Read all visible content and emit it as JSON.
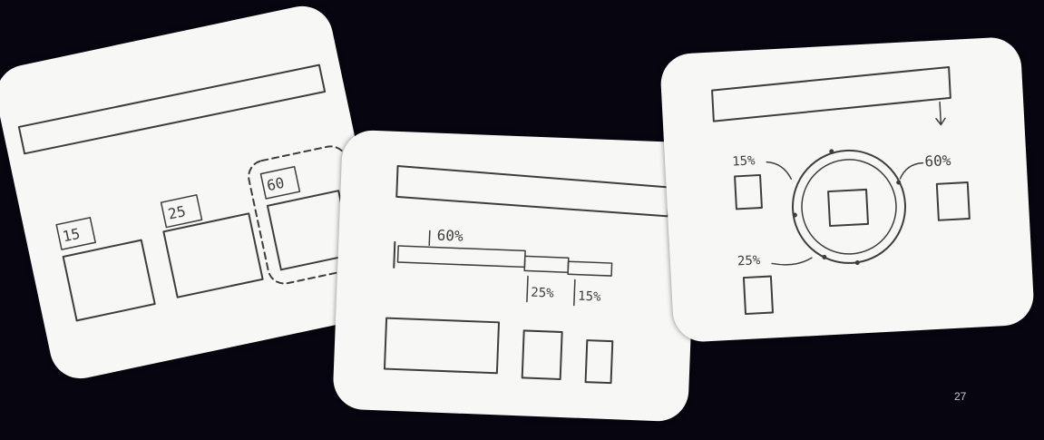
{
  "slide": {
    "page_number": "27",
    "background_color": "#07050f",
    "card_color": "#f7f7f5",
    "ink_color": "#3d3d3d"
  },
  "sketch_1": {
    "labels": [
      "15",
      "25",
      "60"
    ]
  },
  "sketch_2": {
    "bar_labels": [
      "60%",
      "25%",
      "15%"
    ]
  },
  "sketch_3": {
    "labels": [
      "15%",
      "60%",
      "25%"
    ]
  }
}
